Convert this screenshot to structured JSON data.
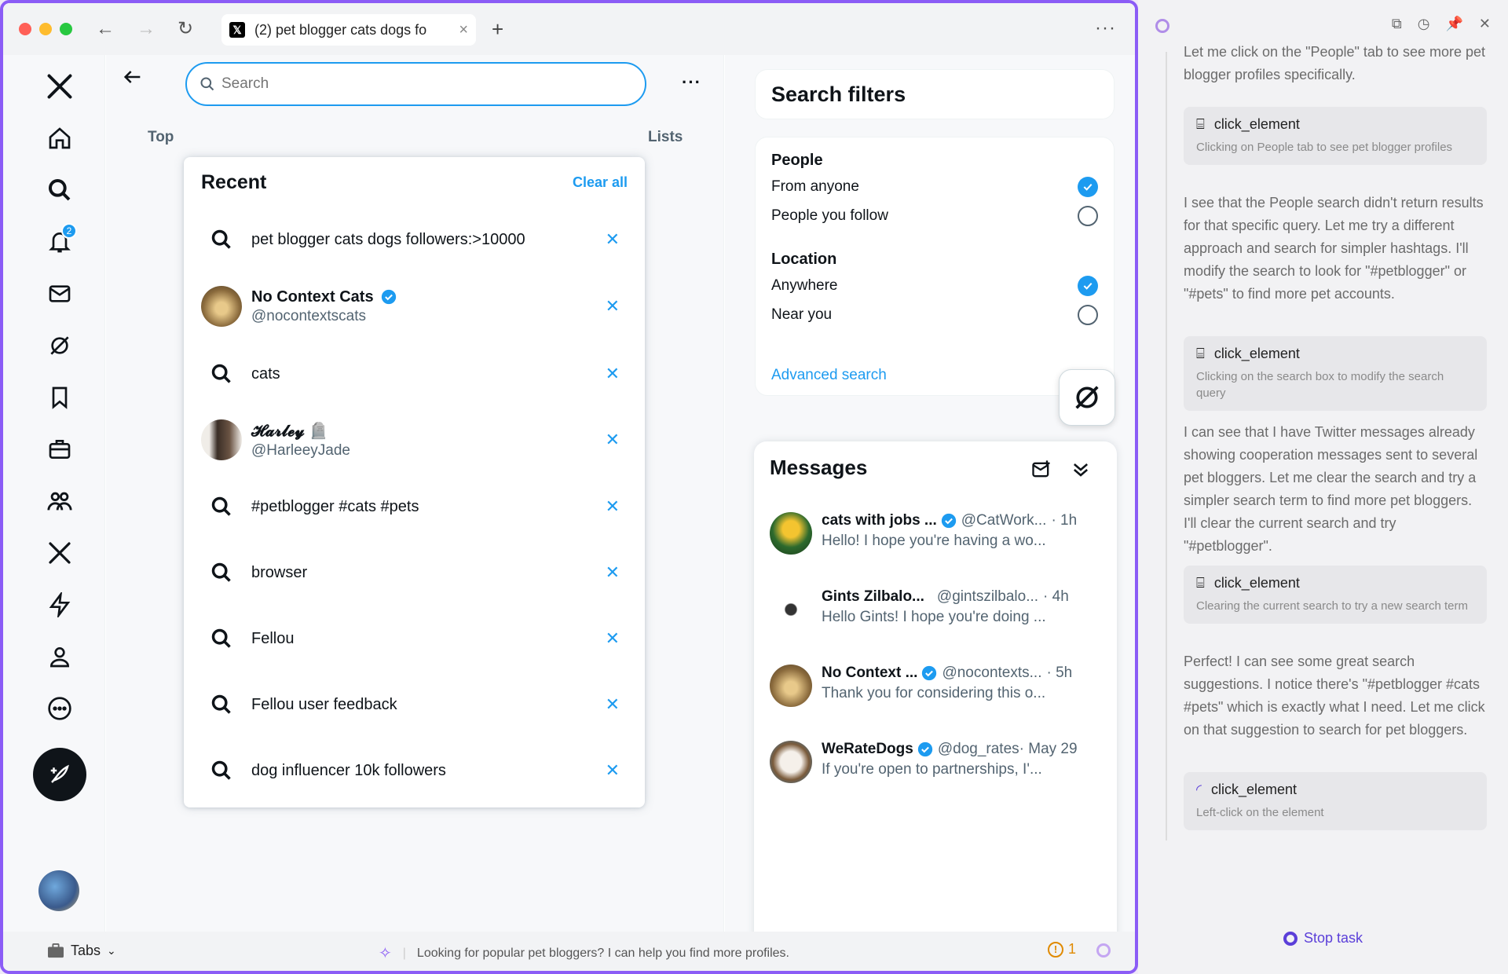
{
  "browser": {
    "tab_title": "(2) pet blogger cats dogs fo",
    "new_tab": "+",
    "more": "···"
  },
  "search": {
    "placeholder": "Search",
    "value": ""
  },
  "center": {
    "tab_top": "Top",
    "tab_lists": "Lists"
  },
  "recent": {
    "title": "Recent",
    "clear_all": "Clear all",
    "items": [
      {
        "type": "query",
        "text": "pet blogger cats dogs followers:>10000"
      },
      {
        "type": "user",
        "name": "No Context Cats",
        "handle": "@nocontextscats",
        "verified": true
      },
      {
        "type": "query",
        "text": "cats"
      },
      {
        "type": "user",
        "name": "𝓗𝓪𝓻𝓵𝓮𝔂 🪦",
        "handle": "@HarleeyJade",
        "verified": false
      },
      {
        "type": "query",
        "text": "#petblogger #cats #pets"
      },
      {
        "type": "query",
        "text": "browser"
      },
      {
        "type": "query",
        "text": "Fellou"
      },
      {
        "type": "query",
        "text": "Fellou user feedback"
      },
      {
        "type": "query",
        "text": "dog influencer 10k followers"
      }
    ]
  },
  "notifications": {
    "count": "2"
  },
  "filters": {
    "title": "Search filters",
    "people_heading": "People",
    "from_anyone": "From anyone",
    "people_you_follow": "People you follow",
    "location_heading": "Location",
    "anywhere": "Anywhere",
    "near_you": "Near you",
    "advanced": "Advanced search"
  },
  "messages": {
    "title": "Messages",
    "items": [
      {
        "name": "cats with jobs ...",
        "handle": "@CatWork...",
        "time": "· 1h",
        "preview": "Hello! I hope you're having a wo...",
        "verified": true
      },
      {
        "name": "Gints Zilbalo...",
        "handle": "@gintszilbalo...",
        "time": "· 4h",
        "preview": "Hello Gints! I hope you're doing ...",
        "verified": false
      },
      {
        "name": "No Context ...",
        "handle": "@nocontexts...",
        "time": "· 5h",
        "preview": "Thank you for considering this o...",
        "verified": true
      },
      {
        "name": "WeRateDogs",
        "handle": "@dog_rates",
        "time": "· May 29",
        "preview": "If you're open to partnerships, I'...",
        "verified": true
      }
    ]
  },
  "statusbar": {
    "tabs_label": "Tabs",
    "hint": "Looking for popular pet bloggers? I can help you find more profiles.",
    "warnings": "1"
  },
  "agent": {
    "top_text": "Let me click on the \"People\" tab to see more pet blogger profiles specifically.",
    "steps": [
      {
        "action": "click_element",
        "desc": "Clicking on People tab to see pet blogger profiles"
      },
      {
        "action": "click_element",
        "desc": "Clicking on the search box to modify the search query"
      },
      {
        "action": "click_element",
        "desc": "Clearing the current search to try a new search term"
      },
      {
        "action": "click_element",
        "desc": "Left-click on the element"
      }
    ],
    "texts": [
      "I see that the People search didn't return results for that specific query. Let me try a different approach and search for simpler hashtags. I'll modify the search to look for \"#petblogger\" or \"#pets\" to find more pet accounts.",
      "I can see that I have Twitter messages already showing cooperation messages sent to several pet bloggers. Let me clear the search and try a simpler search term to find more pet bloggers. I'll clear the current search and try \"#petblogger\".",
      "Perfect! I can see some great search suggestions. I notice there's \"#petblogger #cats #pets\" which is exactly what I need. Let me click on that suggestion to search for pet bloggers."
    ],
    "stop_label": "Stop task"
  },
  "colors": {
    "accent": "#1d9bf0",
    "fellou": "#8b5cf6"
  }
}
